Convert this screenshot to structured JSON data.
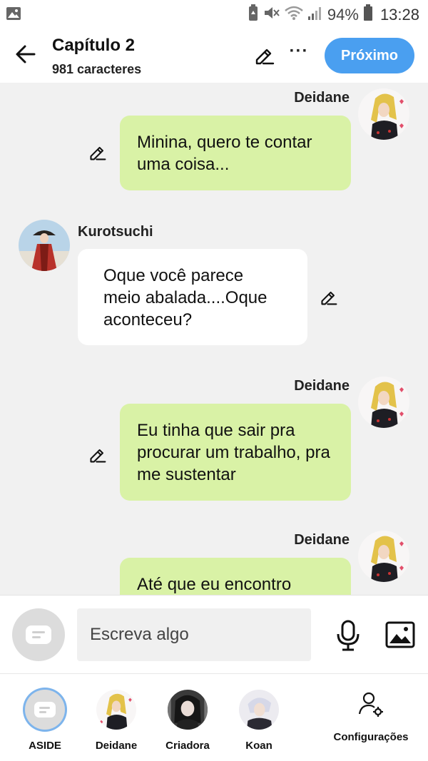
{
  "status_bar": {
    "battery_percent": "94%",
    "time": "13:28",
    "icons": [
      "image-notification-icon",
      "battery-saver-icon",
      "mute-icon",
      "wifi-icon",
      "signal-icon",
      "battery-icon"
    ]
  },
  "header": {
    "title": "Capítulo 2",
    "subtitle": "981 caracteres",
    "next_label": "Próximo",
    "more_label": "···"
  },
  "messages": [
    {
      "side": "right",
      "author": "Deidane",
      "text": "Minina, quero te contar uma coisa..."
    },
    {
      "side": "left",
      "author": "Kurotsuchi",
      "text": "Oque você parece meio abalada....Oque aconteceu?"
    },
    {
      "side": "right",
      "author": "Deidane",
      "text": "Eu tinha que sair pra procurar um trabalho, pra me sustentar"
    },
    {
      "side": "right",
      "author": "Deidane",
      "text": "Até que eu encontro"
    }
  ],
  "input": {
    "placeholder": "Escreva algo"
  },
  "bottom_nav": {
    "items": [
      {
        "label": "ASIDE"
      },
      {
        "label": "Deidane"
      },
      {
        "label": "Criadora"
      },
      {
        "label": "Koan"
      }
    ],
    "settings_label": "Configurações"
  },
  "colors": {
    "accent": "#4a9ff0",
    "right_bubble": "#d9f2a6",
    "left_bubble": "#ffffff",
    "background": "#f1f1f1"
  }
}
